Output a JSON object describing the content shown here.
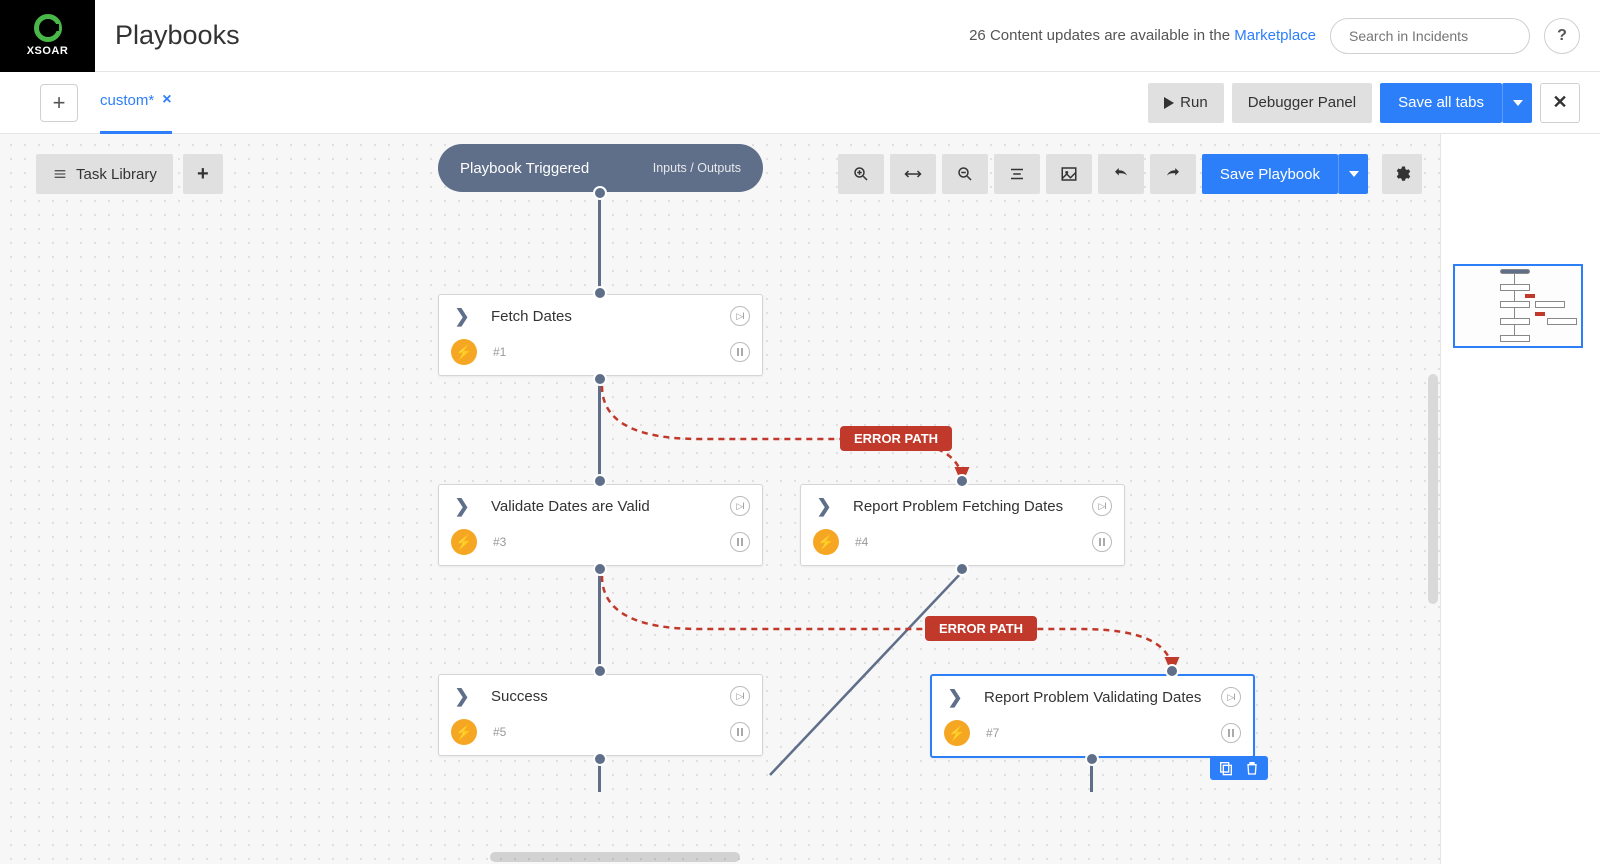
{
  "brand": {
    "name": "XSOAR"
  },
  "header": {
    "title": "Playbooks",
    "updates_prefix": "26 Content updates are available in the ",
    "updates_link": "Marketplace",
    "search_placeholder": "Search in Incidents",
    "help_label": "?"
  },
  "subheader": {
    "tab_label": "custom*",
    "run_label": "Run",
    "debugger_label": "Debugger Panel",
    "save_tabs_label": "Save all tabs"
  },
  "toolbar": {
    "task_library": "Task Library",
    "save_playbook": "Save Playbook"
  },
  "trigger": {
    "title": "Playbook Triggered",
    "io": "Inputs / Outputs"
  },
  "tasks": [
    {
      "title": "Fetch Dates",
      "num": "#1"
    },
    {
      "title": "Validate Dates are Valid",
      "num": "#3"
    },
    {
      "title": "Report Problem Fetching Dates",
      "num": "#4"
    },
    {
      "title": "Success",
      "num": "#5"
    },
    {
      "title": "Report Problem Validating Dates",
      "num": "#7"
    }
  ],
  "error_label": "ERROR PATH"
}
